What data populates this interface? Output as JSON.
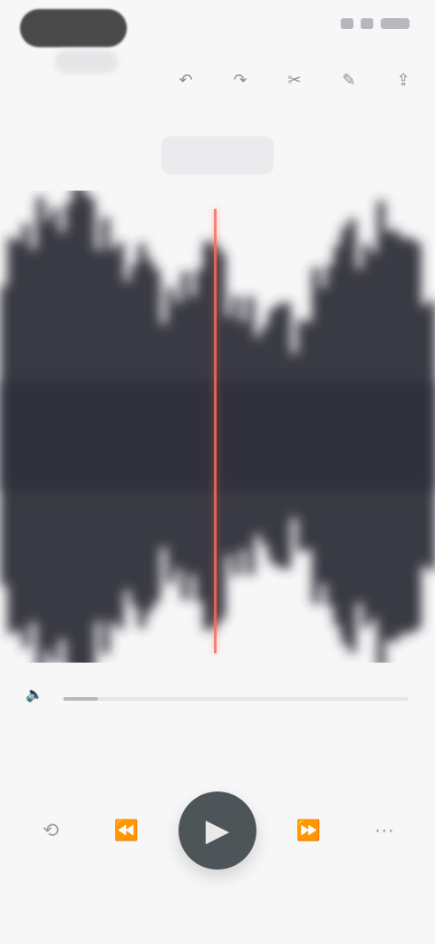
{
  "status": {
    "left_pill": "",
    "indicators": [
      "signal-icon",
      "wifi-icon",
      "battery-icon"
    ]
  },
  "toolbar": {
    "icons": [
      "undo-icon",
      "redo-icon",
      "trim-icon",
      "edit-icon",
      "share-icon"
    ]
  },
  "recording": {
    "timestamp": ""
  },
  "waveform": {
    "playhead_color": "#ff6b5a",
    "wave_color": "#2b2a37"
  },
  "scrubber": {
    "left_icon": "speaker-icon",
    "right_label": "",
    "progress": 0.1
  },
  "controls": {
    "buttons": [
      "speed-icon",
      "rewind-15-icon",
      "play-icon",
      "forward-15-icon",
      "more-icon"
    ]
  }
}
